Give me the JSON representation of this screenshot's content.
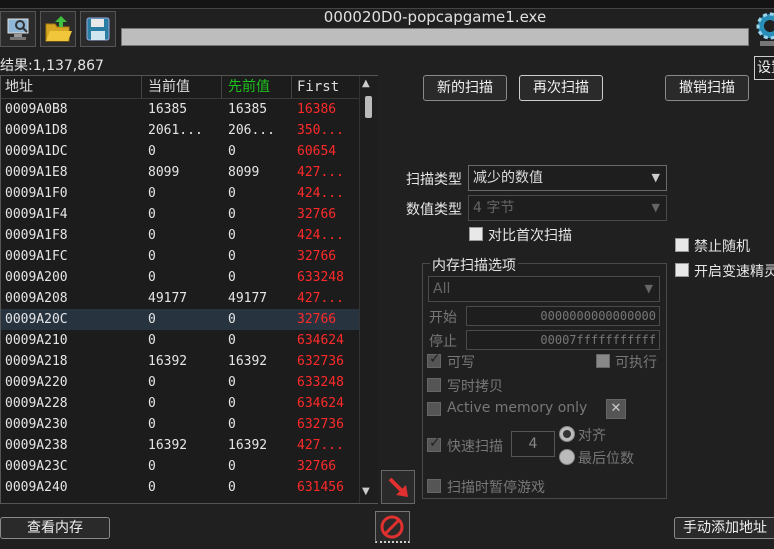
{
  "window": {
    "process_title": "000020D0-popcapgame1.exe"
  },
  "toolbar": {
    "open_process_icon": "computer-icon",
    "open_file_icon": "folder-open-icon",
    "save_icon": "floppy-disk-icon",
    "settings_label": "设置"
  },
  "results": {
    "label": "结果:1,137,867"
  },
  "list": {
    "headers": {
      "address": "地址",
      "value": "当前值",
      "previous": "先前值",
      "first": "First"
    },
    "header_colors": {
      "previous": "#1ec21e"
    },
    "rows": [
      {
        "address": "0009A0B8",
        "value": "16385",
        "previous": "16385",
        "first": "16386"
      },
      {
        "address": "0009A1D8",
        "value": "2061...",
        "previous": "206...",
        "first": "350..."
      },
      {
        "address": "0009A1DC",
        "value": "0",
        "previous": "0",
        "first": "60654"
      },
      {
        "address": "0009A1E8",
        "value": "8099",
        "previous": "8099",
        "first": "427..."
      },
      {
        "address": "0009A1F0",
        "value": "0",
        "previous": "0",
        "first": "424..."
      },
      {
        "address": "0009A1F4",
        "value": "0",
        "previous": "0",
        "first": "32766"
      },
      {
        "address": "0009A1F8",
        "value": "0",
        "previous": "0",
        "first": "424..."
      },
      {
        "address": "0009A1FC",
        "value": "0",
        "previous": "0",
        "first": "32766"
      },
      {
        "address": "0009A200",
        "value": "0",
        "previous": "0",
        "first": "633248"
      },
      {
        "address": "0009A208",
        "value": "49177",
        "previous": "49177",
        "first": "427..."
      },
      {
        "address": "0009A20C",
        "value": "0",
        "previous": "0",
        "first": "32766"
      },
      {
        "address": "0009A210",
        "value": "0",
        "previous": "0",
        "first": "634624"
      },
      {
        "address": "0009A218",
        "value": "16392",
        "previous": "16392",
        "first": "632736"
      },
      {
        "address": "0009A220",
        "value": "0",
        "previous": "0",
        "first": "633248"
      },
      {
        "address": "0009A228",
        "value": "0",
        "previous": "0",
        "first": "634624"
      },
      {
        "address": "0009A230",
        "value": "0",
        "previous": "0",
        "first": "632736"
      },
      {
        "address": "0009A238",
        "value": "16392",
        "previous": "16392",
        "first": "427..."
      },
      {
        "address": "0009A23C",
        "value": "0",
        "previous": "0",
        "first": "32766"
      },
      {
        "address": "0009A240",
        "value": "0",
        "previous": "0",
        "first": "631456"
      }
    ],
    "selected_row": 10
  },
  "scan": {
    "new_scan": "新的扫描",
    "next_scan": "再次扫描",
    "undo_scan": "撤销扫描",
    "scan_type_label": "扫描类型",
    "scan_type_value": "减少的数值",
    "value_type_label": "数值类型",
    "value_type_value": "4 字节",
    "compare_first_label": "对比首次扫描",
    "disable_random_label": "禁止随机",
    "speedhack_label": "开启变速精灵"
  },
  "memory_options": {
    "title": "内存扫描选项",
    "region_value": "All",
    "start_label": "开始",
    "start_value": "0000000000000000",
    "stop_label": "停止",
    "stop_value": "00007fffffffffff",
    "writable_label": "可写",
    "executable_label": "可执行",
    "copy_on_write_label": "写时拷贝",
    "active_memory_label": "Active memory only",
    "fast_scan_label": "快速扫描",
    "fast_scan_value": "4",
    "align_label": "对齐",
    "last_digits_label": "最后位数",
    "pause_game_label": "扫描时暂停游戏"
  },
  "bottom": {
    "view_memory": "查看内存",
    "add_address_manually": "手动添加地址"
  },
  "colors": {
    "first_value": "#ff2a2a",
    "selected_row": "#283340",
    "background": "#202020"
  }
}
